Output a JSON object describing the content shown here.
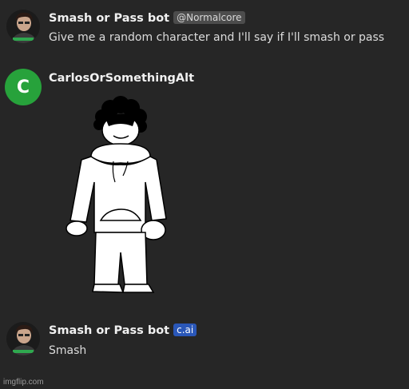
{
  "messages": [
    {
      "author": "Smash or Pass bot",
      "badge": "@Normalcore",
      "text": "Give me a random character and I'll say if I'll smash or pass"
    },
    {
      "author": "CarlosOrSomethingAlt",
      "avatar_letter": "C",
      "avatar_color": "#27a23b"
    },
    {
      "author": "Smash or Pass bot",
      "badge": "c.ai",
      "badge_color": "#2a57b8",
      "text": "Smash"
    }
  ],
  "watermark": "imgflip.com"
}
